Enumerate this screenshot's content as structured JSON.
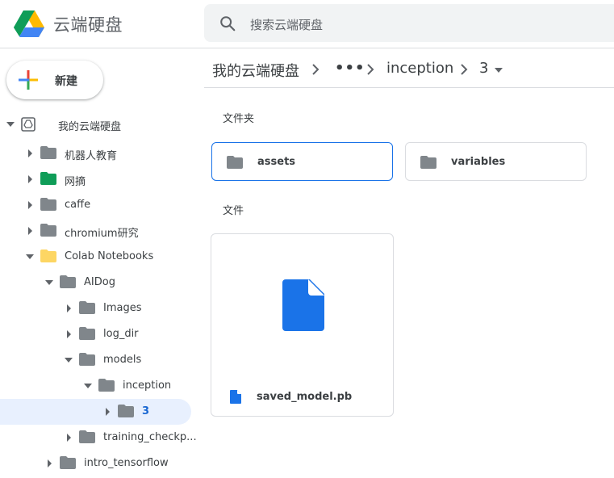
{
  "app": {
    "title": "云端硬盘"
  },
  "search": {
    "placeholder": "搜索云端硬盘"
  },
  "new_button": {
    "label": "新建"
  },
  "sidebar": {
    "root": "我的云端硬盘",
    "items": [
      {
        "label": "机器人教育"
      },
      {
        "label": "网摘"
      },
      {
        "label": "caffe"
      },
      {
        "label": "chromium研究"
      },
      {
        "label": "Colab Notebooks"
      },
      {
        "label": "AIDog"
      },
      {
        "label": "Images"
      },
      {
        "label": "log_dir"
      },
      {
        "label": "models"
      },
      {
        "label": "inception"
      },
      {
        "label": "3"
      },
      {
        "label": "training_checkp..."
      },
      {
        "label": "intro_tensorflow"
      }
    ]
  },
  "breadcrumb": {
    "root": "我的云端硬盘",
    "ellipsis": "•••",
    "parent": "inception",
    "current": "3"
  },
  "sections": {
    "folders": "文件夹",
    "files": "文件"
  },
  "folders": [
    {
      "name": "assets"
    },
    {
      "name": "variables"
    }
  ],
  "files": [
    {
      "name": "saved_model.pb"
    }
  ],
  "colors": {
    "accent": "#1a73e8",
    "folder_gray": "#80868b",
    "folder_green": "#0f9d58",
    "folder_yellow": "#fdd663",
    "selected_bg": "#e8f0fe"
  }
}
